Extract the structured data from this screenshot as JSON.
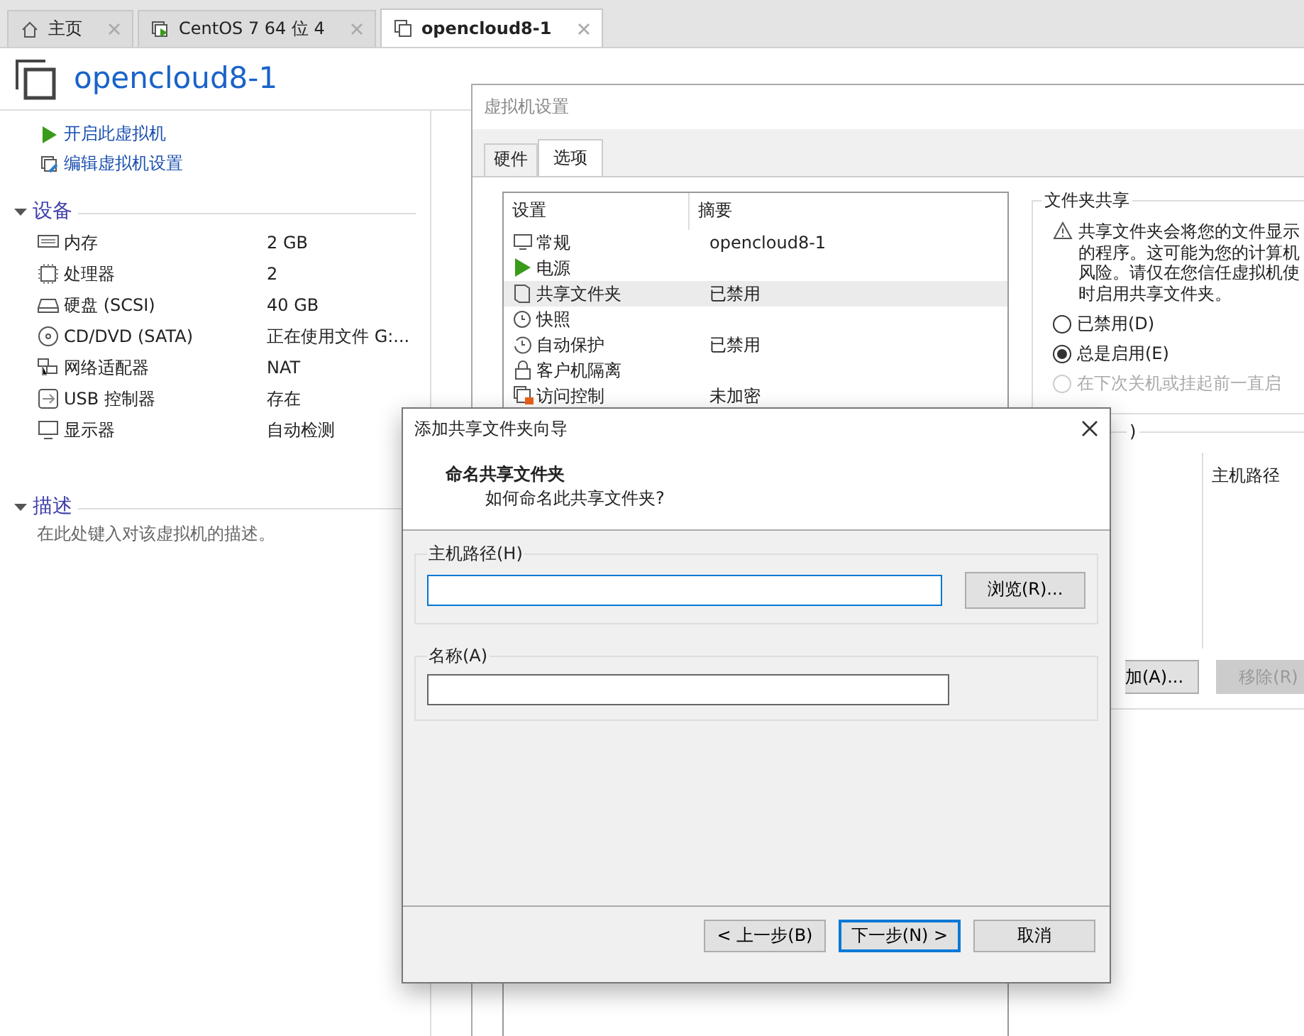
{
  "tabs": [
    {
      "label": "主页",
      "selected": false
    },
    {
      "label": "CentOS 7 64 位 4",
      "selected": false
    },
    {
      "label": "opencloud8-1",
      "selected": true
    }
  ],
  "vm": {
    "title": "opencloud8-1",
    "actions": [
      "开启此虚拟机",
      "编辑虚拟机设置"
    ],
    "devices_heading": "设备",
    "devices": [
      {
        "name": "内存",
        "value": "2 GB"
      },
      {
        "name": "处理器",
        "value": "2"
      },
      {
        "name": "硬盘 (SCSI)",
        "value": "40 GB"
      },
      {
        "name": "CD/DVD (SATA)",
        "value": "正在使用文件 G:..."
      },
      {
        "name": "网络适配器",
        "value": "NAT"
      },
      {
        "name": "USB 控制器",
        "value": "存在"
      },
      {
        "name": "显示器",
        "value": "自动检测"
      }
    ],
    "description_heading": "描述",
    "description_placeholder": "在此处键入对该虚拟机的描述。"
  },
  "settings": {
    "title": "虚拟机设置",
    "tabs": [
      {
        "label": "硬件",
        "selected": false
      },
      {
        "label": "选项",
        "selected": true
      }
    ],
    "columns": [
      "设置",
      "摘要"
    ],
    "rows": [
      {
        "name": "常规",
        "summary": "opencloud8-1",
        "selected": false
      },
      {
        "name": "电源",
        "selected": false
      },
      {
        "name": "共享文件夹",
        "summary": "已禁用",
        "selected": true
      },
      {
        "name": "快照",
        "selected": false
      },
      {
        "name": "自动保护",
        "summary": "已禁用",
        "selected": false
      },
      {
        "name": "客户机隔离",
        "selected": false
      },
      {
        "name": "访问控制",
        "summary": "未加密",
        "selected": false
      }
    ],
    "folder_sharing": {
      "title": "文件夹共享",
      "warning_lines": [
        "共享文件夹会将您的文件显示",
        "的程序。这可能为您的计算机",
        "风险。请仅在您信任虚拟机使",
        "时启用共享文件夹。"
      ],
      "options": [
        {
          "label": "已禁用(D)",
          "selected": false,
          "disabled": false
        },
        {
          "label": "总是启用(E)",
          "selected": true,
          "disabled": false
        },
        {
          "label": "在下次关机或挂起前一直启",
          "selected": false,
          "disabled": true
        }
      ]
    },
    "folders": {
      "label_tail": ")",
      "columns": [
        "主机路径"
      ],
      "buttons": [
        {
          "label": "加(A)...",
          "disabled": false
        },
        {
          "label": "移除(R)",
          "disabled": true
        }
      ]
    }
  },
  "wizard": {
    "title": "添加共享文件夹向导",
    "heading": "命名共享文件夹",
    "subheading": "如何命名此共享文件夹?",
    "host_path_label": "主机路径(H)",
    "browse_button": "浏览(R)...",
    "name_label": "名称(A)",
    "buttons": [
      {
        "label": "< 上一步(B)",
        "default": false
      },
      {
        "label": "下一步(N) >",
        "default": true
      },
      {
        "label": "取消",
        "default": false
      }
    ]
  }
}
